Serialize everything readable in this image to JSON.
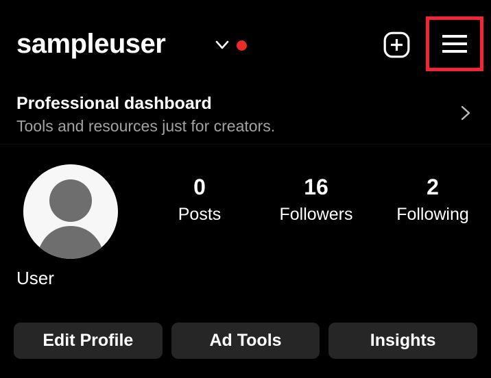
{
  "theme": {
    "background": "#000000",
    "text_primary": "#ffffff",
    "text_secondary": "#a3a3a3",
    "button_background": "#262626",
    "highlight_border": "#F42434",
    "notification_dot": "#ED2A2A",
    "avatar_background": "#f7f7f7",
    "avatar_figure": "#6e6e6e"
  },
  "topbar": {
    "username": "sampleuser",
    "account_switcher_icon": "chevron-down-icon",
    "notification_dot_label": "",
    "create_icon": "plus-square-icon",
    "menu_icon": "hamburger-menu-icon",
    "menu_highlighted": true
  },
  "dashboard": {
    "title": "Professional dashboard",
    "subtitle": "Tools and resources just for creators.",
    "chevron_icon": "chevron-right-icon"
  },
  "profile": {
    "avatar_icon": "default-avatar-icon",
    "display_name": "User",
    "stats": [
      {
        "value": "0",
        "label": "Posts"
      },
      {
        "value": "16",
        "label": "Followers"
      },
      {
        "value": "2",
        "label": "Following"
      }
    ]
  },
  "actions": [
    {
      "label": "Edit Profile"
    },
    {
      "label": "Ad Tools"
    },
    {
      "label": "Insights"
    }
  ]
}
